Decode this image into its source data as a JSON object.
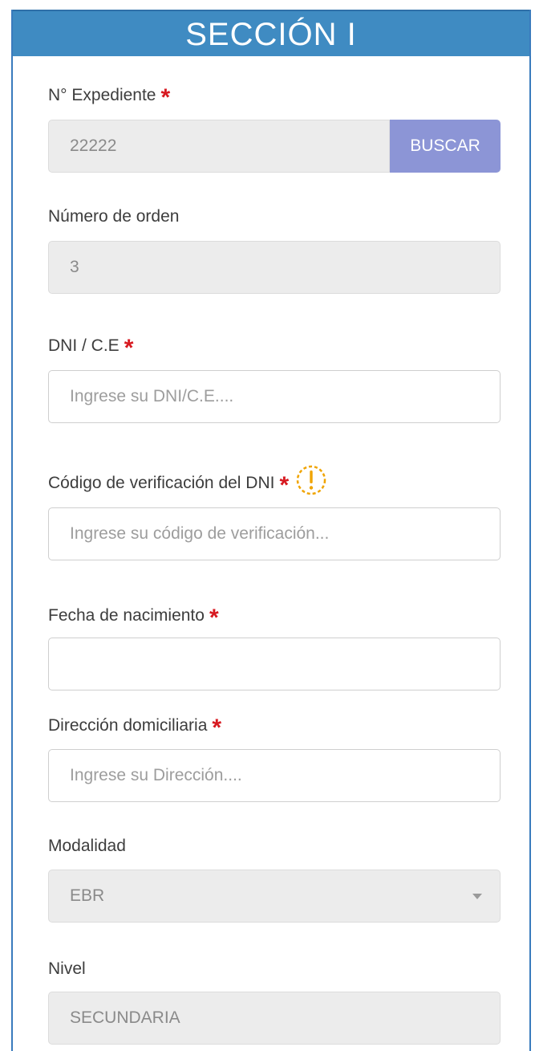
{
  "header": {
    "title": "SECCIÓN I"
  },
  "fields": {
    "expediente": {
      "label": "N° Expediente",
      "required_mark": "*",
      "value": "22222",
      "button_label": "BUSCAR"
    },
    "numero_orden": {
      "label": "Número de orden",
      "value": "3"
    },
    "dni": {
      "label": "DNI / C.E",
      "required_mark": "*",
      "placeholder": "Ingrese su DNI/C.E...."
    },
    "codigo_verificacion": {
      "label": "Código de verificación del DNI",
      "required_mark": "*",
      "placeholder": "Ingrese su código de verificación...",
      "info_icon": "warning-circle-icon"
    },
    "fecha_nacimiento": {
      "label": "Fecha de nacimiento",
      "required_mark": "*",
      "value": ""
    },
    "direccion": {
      "label": "Dirección domiciliaria",
      "required_mark": "*",
      "placeholder": "Ingrese su Dirección...."
    },
    "modalidad": {
      "label": "Modalidad",
      "selected": "EBR"
    },
    "nivel": {
      "label": "Nivel",
      "value": "SECUNDARIA"
    }
  },
  "colors": {
    "header_bg": "#3f8bc2",
    "required": "#d71920",
    "button_bg": "#8c95d6",
    "warning": "#f0a400",
    "readonly_bg": "#ececec"
  }
}
